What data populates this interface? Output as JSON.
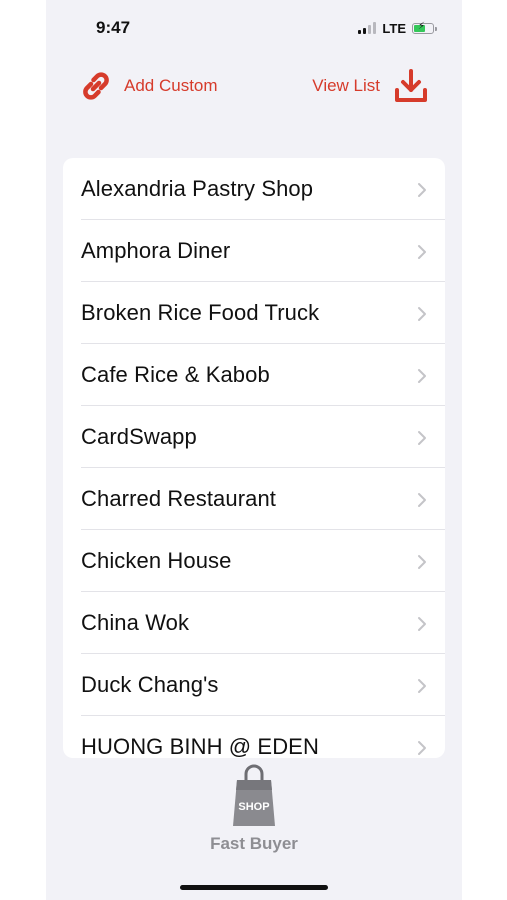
{
  "status_bar": {
    "time": "9:47",
    "network": "LTE",
    "signal_bars_active": 2,
    "battery_level": 0.55,
    "battery_charging": true
  },
  "toolbar": {
    "add_custom_label": "Add Custom",
    "view_list_label": "View List",
    "accent_color": "#d63b2b"
  },
  "restaurants": [
    {
      "label": "Alexandria Pastry Shop"
    },
    {
      "label": "Amphora Diner"
    },
    {
      "label": "Broken Rice Food Truck"
    },
    {
      "label": "Cafe Rice & Kabob"
    },
    {
      "label": "CardSwapp"
    },
    {
      "label": "Charred Restaurant"
    },
    {
      "label": "Chicken House"
    },
    {
      "label": "China Wok"
    },
    {
      "label": "Duck Chang's"
    },
    {
      "label": "HUONG BINH @ EDEN"
    }
  ],
  "tab_bar": {
    "item_label": "Fast Buyer",
    "bag_label": "SHOP",
    "icon": "shopping-bag-icon"
  }
}
